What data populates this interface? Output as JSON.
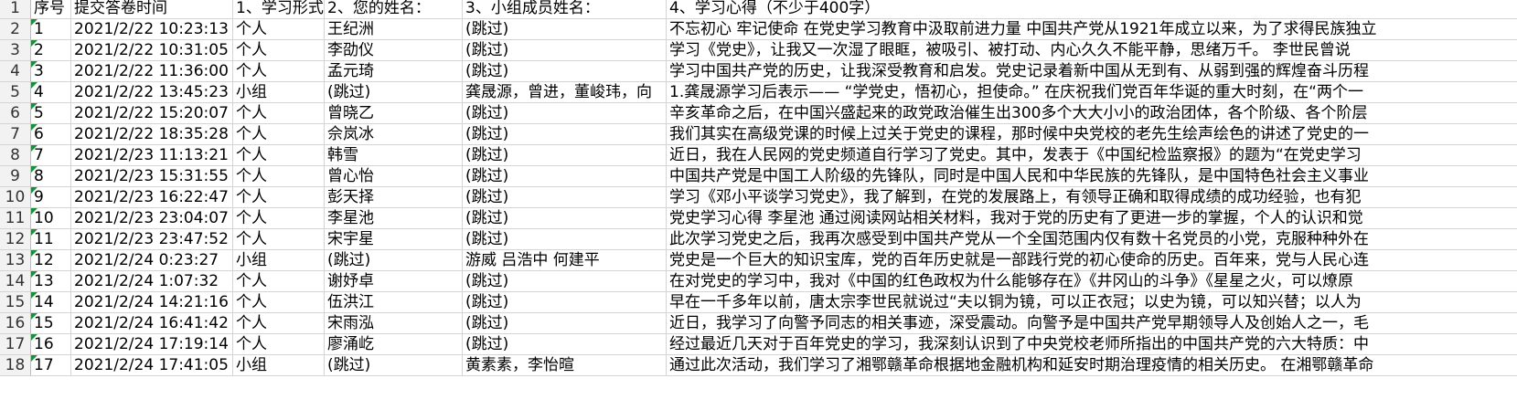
{
  "sheet": {
    "headers": [
      "序号",
      "提交答卷时间",
      "1、学习形式",
      "2、您的姓名：",
      "3、小组成员姓名：",
      "4、学习心得（不少于400字）"
    ],
    "rows": [
      [
        "1",
        "2021/2/22 10:23:13",
        "个人",
        "王纪洲",
        "(跳过)",
        "不忘初心 牢记使命 在党史学习教育中汲取前进力量 中国共产党从1921年成立以来，为了求得民族独立"
      ],
      [
        "2",
        "2021/2/22 10:31:05",
        "个人",
        "李劭仪",
        "(跳过)",
        "学习《党史》，让我又一次湿了眼眶，被吸引、被打动、内心久久不能平静，思绪万千。 李世民曾说"
      ],
      [
        "3",
        "2021/2/22 11:36:00",
        "个人",
        "孟元琦",
        "(跳过)",
        "学习中国共产党的历史，让我深受教育和启发。党史记录着新中国从无到有、从弱到强的辉煌奋斗历程"
      ],
      [
        "4",
        "2021/2/22 13:45:23",
        "小组",
        "(跳过)",
        "龚晟源，曾进，董峻玮，向",
        "1.龚晟源学习后表示—— “学党史，悟初心，担使命。” 在庆祝我们党百年华诞的重大时刻，在“两个一"
      ],
      [
        "5",
        "2021/2/22 15:20:07",
        "个人",
        "曾晓乙",
        "(跳过)",
        "辛亥革命之后，在中国兴盛起来的政党政治催生出300多个大大小小的政治团体，各个阶级、各个阶层"
      ],
      [
        "6",
        "2021/2/22 18:35:28",
        "个人",
        "佘岚冰",
        "(跳过)",
        "我们其实在高级党课的时候上过关于党史的课程，那时候中央党校的老先生绘声绘色的讲述了党史的一"
      ],
      [
        "7",
        "2021/2/23 11:13:21",
        "个人",
        "韩雪",
        "(跳过)",
        "近日，我在人民网的党史频道自行学习了党史。其中，发表于《中国纪检监察报》的题为“在党史学习"
      ],
      [
        "8",
        "2021/2/23 15:31:55",
        "个人",
        "曾心怡",
        "(跳过)",
        "中国共产党是中国工人阶级的先锋队，同时是中国人民和中华民族的先锋队，是中国特色社会主义事业"
      ],
      [
        "9",
        "2021/2/23 16:22:47",
        "个人",
        "彭天择",
        "(跳过)",
        "学习《邓小平谈学习党史》，我了解到，在党的发展路上，有领导正确和取得成绩的成功经验，也有犯"
      ],
      [
        "10",
        "2021/2/23 23:04:07",
        "个人",
        "李星池",
        "(跳过)",
        "党史学习心得 李星池 通过阅读网站相关材料，我对于党的历史有了更进一步的掌握，个人的认识和觉"
      ],
      [
        "11",
        "2021/2/23 23:47:52",
        "个人",
        "宋宇星",
        "(跳过)",
        "此次学习党史之后，我再次感受到中国共产党从一个全国范围内仅有数十名党员的小党，克服种种外在"
      ],
      [
        "12",
        "2021/2/24 0:23:27",
        "小组",
        "(跳过)",
        "游威 吕浩中 何建平",
        "党史是一个巨大的知识宝库，党的百年历史就是一部践行党的初心使命的历史。百年来，党与人民心连"
      ],
      [
        "13",
        "2021/2/24 1:07:32",
        "个人",
        "谢妤卓",
        "(跳过)",
        "在对党史的学习中，我对《中国的红色政权为什么能够存在》《井冈山的斗争》《星星之火，可以燎原"
      ],
      [
        "14",
        "2021/2/24 14:21:16",
        "个人",
        "伍洪江",
        "(跳过)",
        "早在一千多年以前，唐太宗李世民就说过“夫以铜为镜，可以正衣冠；以史为镜，可以知兴替；以人为"
      ],
      [
        "15",
        "2021/2/24 16:41:42",
        "个人",
        "宋雨泓",
        "(跳过)",
        "近日，我学习了向警予同志的相关事迹，深受震动。向警予是中国共产党早期领导人及创始人之一，毛"
      ],
      [
        "16",
        "2021/2/24 17:19:14",
        "个人",
        "廖涌屹",
        "(跳过)",
        "经过最近几天对于百年党史的学习，我深刻认识到了中央党校老师所指出的中国共产党的六大特质：中"
      ],
      [
        "17",
        "2021/2/24 17:41:05",
        "小组",
        "(跳过)",
        "黄素素，李怡暄",
        "通过此次活动，我们学习了湘鄂赣革命根据地金融机构和延安时期治理疫情的相关历史。 在湘鄂赣革命"
      ]
    ],
    "row_numbers": [
      "1",
      "2",
      "3",
      "4",
      "5",
      "6",
      "7",
      "8",
      "9",
      "10",
      "11",
      "12",
      "13",
      "14",
      "15",
      "16",
      "17",
      "18"
    ],
    "colors": {
      "grid_line": "#d4d4d4",
      "error_indicator": "#1e8e3e",
      "row_header_bg": "#f2f2f2"
    }
  }
}
